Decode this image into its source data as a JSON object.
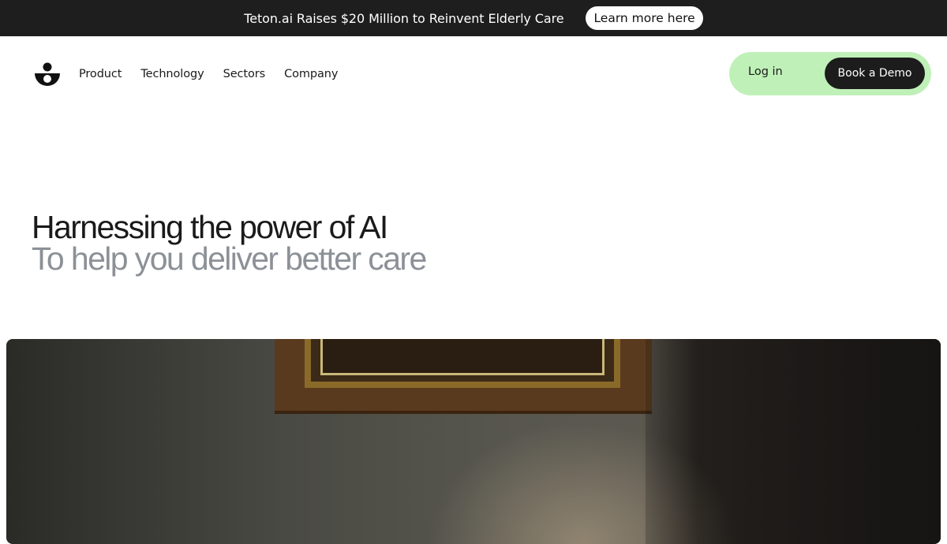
{
  "announcement": {
    "text": "Teton.ai Raises $20 Million to Reinvent Elderly Care",
    "button_label": "Learn more here"
  },
  "nav": {
    "logo": "teton-logo-icon",
    "links": [
      {
        "label": "Product"
      },
      {
        "label": "Technology"
      },
      {
        "label": "Sectors"
      },
      {
        "label": "Company"
      }
    ],
    "login_label": "Log in",
    "demo_label": "Book a Demo",
    "pill_color": "#bff0b8"
  },
  "hero": {
    "title": "Harnessing the power of AI",
    "subtitle": "To help you deliver better care"
  },
  "colors": {
    "announcement_bg": "#1e1e1e",
    "accent_green": "#bff0b8",
    "dark_button": "#1c1c1c",
    "subtitle_gray": "#8c9197"
  }
}
